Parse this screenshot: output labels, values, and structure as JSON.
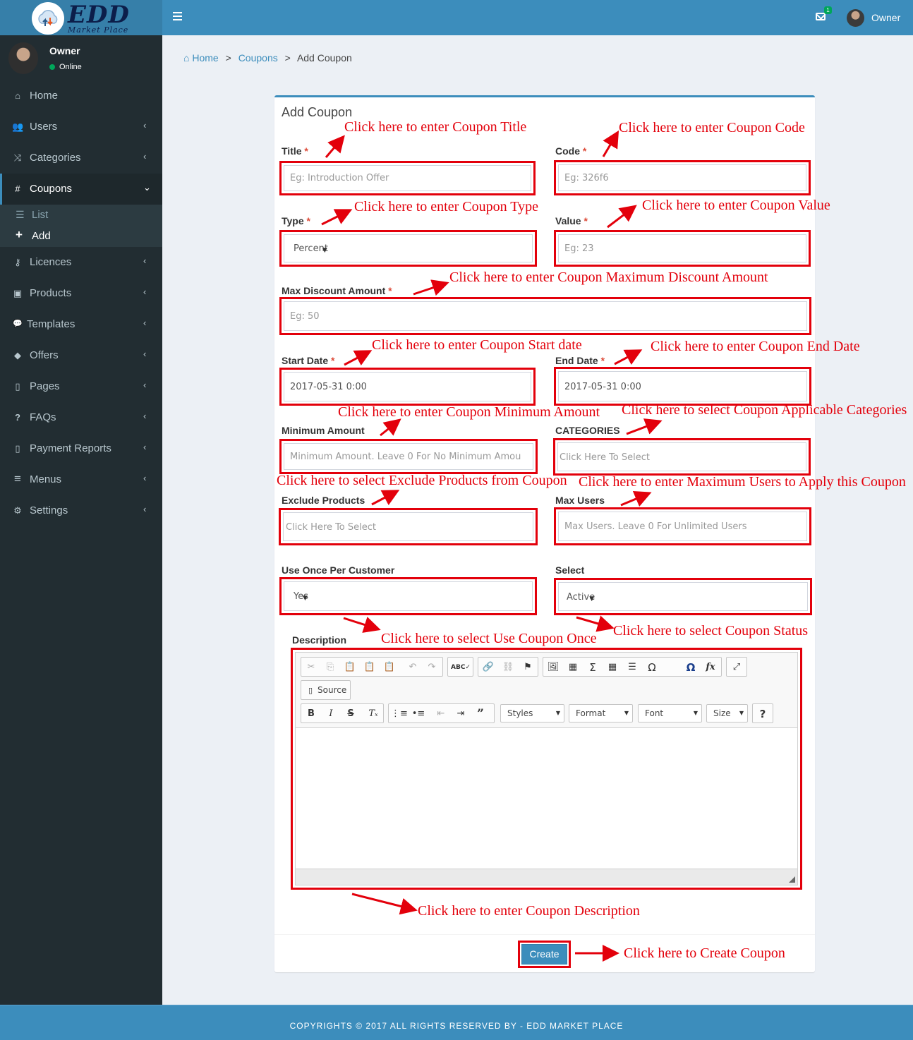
{
  "brand": {
    "title": "EDD",
    "subtitle": "Market Place"
  },
  "header": {
    "mail_count": "1",
    "user": "Owner"
  },
  "sidebar": {
    "user_name": "Owner",
    "user_status": "Online",
    "items": [
      {
        "label": "Home",
        "icon": "home-icon",
        "glyph": "⌂"
      },
      {
        "label": "Users",
        "icon": "users-icon",
        "glyph": "👥"
      },
      {
        "label": "Categories",
        "icon": "shuffle-icon",
        "glyph": "⤨"
      },
      {
        "label": "Coupons",
        "icon": "hash-icon",
        "glyph": "#"
      },
      {
        "label": "Licences",
        "icon": "key-icon",
        "glyph": "⚷"
      },
      {
        "label": "Products",
        "icon": "shopping-bag-icon",
        "glyph": "▣"
      },
      {
        "label": "Templates",
        "icon": "comment-icon",
        "glyph": "💬"
      },
      {
        "label": "Offers",
        "icon": "tags-icon",
        "glyph": "◆"
      },
      {
        "label": "Pages",
        "icon": "file-icon",
        "glyph": "▯"
      },
      {
        "label": "FAQs",
        "icon": "question-icon",
        "glyph": "?"
      },
      {
        "label": "Payment Reports",
        "icon": "file-icon",
        "glyph": "▯"
      },
      {
        "label": "Menus",
        "icon": "bars-icon",
        "glyph": "≡"
      },
      {
        "label": "Settings",
        "icon": "gear-icon",
        "glyph": "⚙"
      }
    ],
    "sub_items": [
      {
        "label": "List",
        "icon": "list-icon",
        "glyph": "☰"
      },
      {
        "label": "Add",
        "icon": "plus-icon",
        "glyph": "+"
      }
    ]
  },
  "breadcrumb": {
    "home": "Home",
    "coupons": "Coupons",
    "current": "Add Coupon",
    "sep": ">"
  },
  "form": {
    "title": "Add Coupon",
    "required_mark": "*",
    "title_label": "Title",
    "title_placeholder": "Eg: Introduction Offer",
    "code_label": "Code",
    "code_placeholder": "Eg: 326f6",
    "type_label": "Type",
    "type_value": "Percent",
    "value_label": "Value",
    "value_placeholder": "Eg: 23",
    "max_discount_label": "Max Discount Amount",
    "max_discount_placeholder": "Eg: 50",
    "start_label": "Start Date",
    "start_value": "2017-05-31 0:00",
    "end_label": "End Date",
    "end_value": "2017-05-31 0:00",
    "min_amount_label": "Minimum Amount",
    "min_amount_placeholder": "Minimum Amount. Leave 0 For No Minimum Amou",
    "categories_label": "CATEGORIES",
    "categories_placeholder": "Click Here To Select",
    "exclude_label": "Exclude Products",
    "exclude_placeholder": "Click Here To Select",
    "max_users_label": "Max Users",
    "max_users_placeholder": "Max Users. Leave 0 For Unlimited Users",
    "use_once_label": "Use Once Per Customer",
    "use_once_value": "Yes",
    "status_label": "Select",
    "status_value": "Active",
    "description_label": "Description",
    "create_label": "Create"
  },
  "editor": {
    "source_label": "Source",
    "styles": "Styles",
    "format": "Format",
    "font": "Font",
    "size": "Size"
  },
  "annotations": {
    "title": "Click here to enter Coupon Title",
    "code": "Click here to enter Coupon Code",
    "type": "Click here to enter Coupon Type",
    "value": "Click here to enter Coupon Value",
    "max_discount": "Click here to enter Coupon Maximum Discount Amount",
    "start": "Click here to enter Coupon Start date",
    "end": "Click here to enter Coupon End Date",
    "min_amount": "Click here to enter Coupon Minimum Amount",
    "categories": "Click here to select Coupon Applicable Categories",
    "exclude": "Click here to select Exclude Products from Coupon",
    "max_users": "Click here to enter Maximum Users to Apply this Coupon",
    "use_once": "Click here to select Use Coupon Once",
    "status": "Click here to select Coupon Status",
    "description": "Click here to enter Coupon Description",
    "create": "Click here to Create Coupon"
  },
  "footer": {
    "text": "COPYRIGHTS © 2017 ALL RIGHTS RESERVED BY - EDD MARKET PLACE"
  },
  "colors": {
    "primary": "#3c8dbc",
    "sidebar": "#222d32",
    "annotation": "#e3000b"
  }
}
